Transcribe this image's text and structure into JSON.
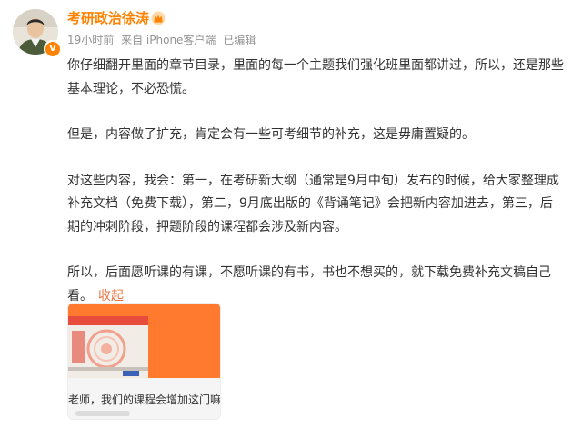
{
  "post": {
    "author": "考研政治徐涛",
    "verified_badge": "V",
    "time": "19小时前",
    "source": "来自 iPhone客户端",
    "edited": "已编辑",
    "paragraphs": [
      "你仔细翻开里面的章节目录，里面的每一个主题我们强化班里面都讲过，所以，还是那些基本理论，不必恐慌。",
      "但是，内容做了扩充，肯定会有一些可考细节的补充，这是毋庸置疑的。",
      "对这些内容，我会：第一，在考研新大纲（通常是9月中旬）发布的时候，给大家整理成补充文档（免费下载），第二，9月底出版的《背诵笔记》会把新内容加进去，第三，后期的冲刺阶段，押题阶段的课程都会涉及新内容。",
      "所以，后面愿听课的有课，不愿听课的有书，书也不想买的，就下载免费补充文稿自己看。"
    ],
    "collapse_label": "收起"
  },
  "card": {
    "text": "老师，我们的课程会增加这门嘛"
  },
  "colors": {
    "username": "#ff8200",
    "link": "#eb7340",
    "meta": "#939393",
    "body": "#333333"
  }
}
